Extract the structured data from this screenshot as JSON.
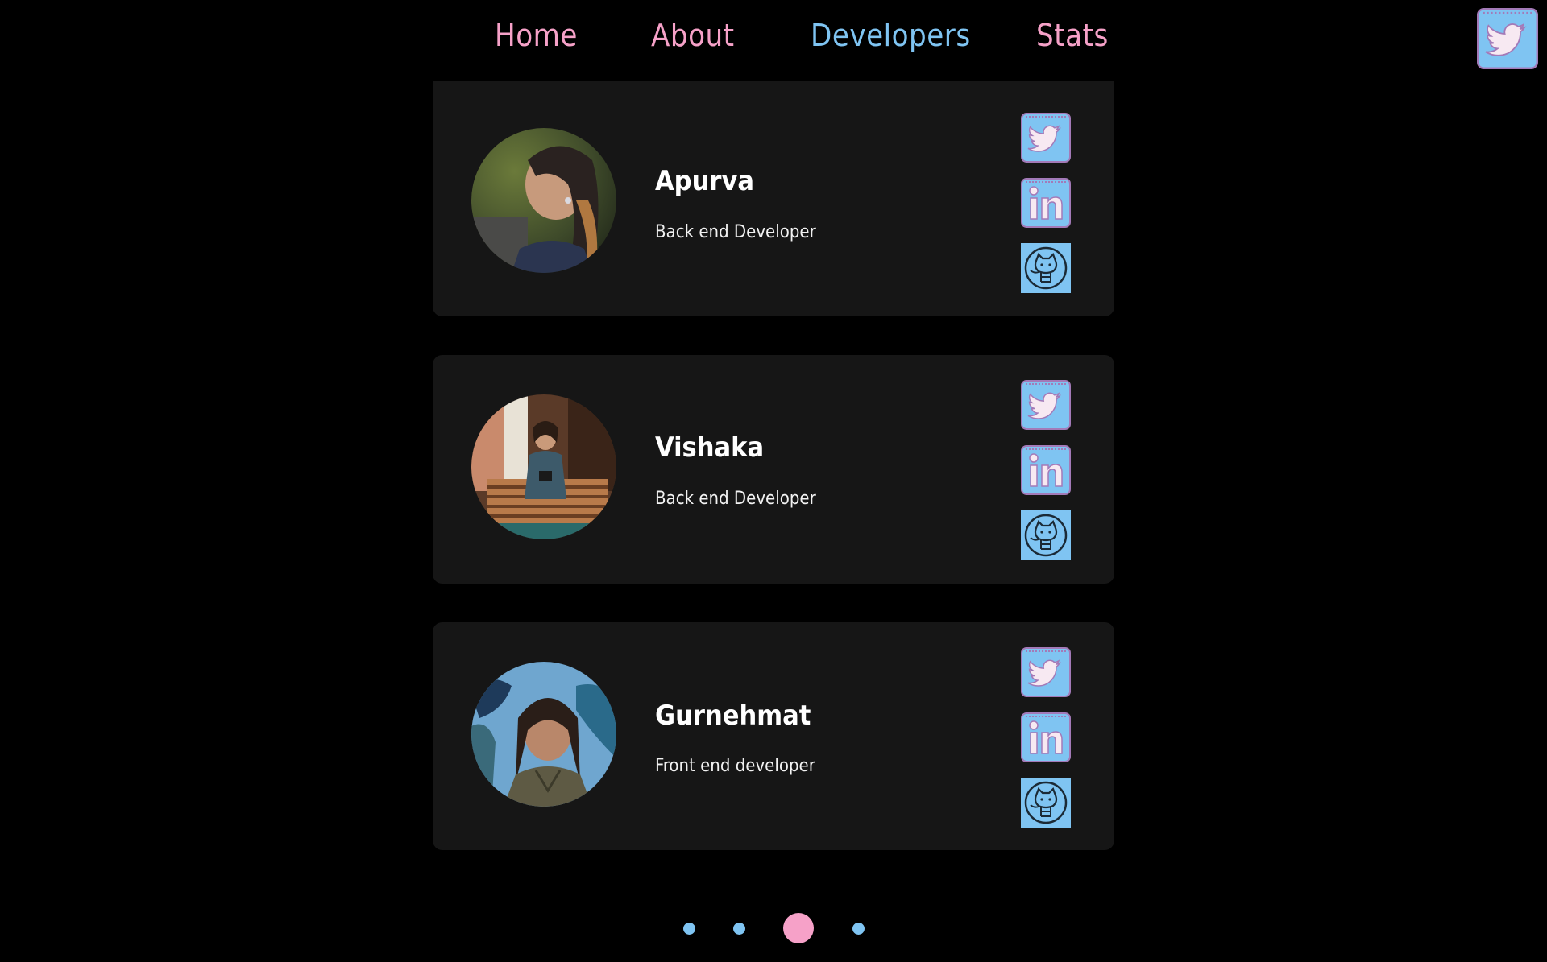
{
  "nav": {
    "home": "Home",
    "about": "About",
    "developers": "Developers",
    "stats": "Stats",
    "active": "developers"
  },
  "colors": {
    "nav_text": "#f6a1c8",
    "nav_active": "#7fc4f2",
    "card_bg": "#161616",
    "icon_bg": "#7fc4f2",
    "icon_border": "#a37ab8",
    "dot": "#7fc4f2",
    "dot_active": "#f6a1c8"
  },
  "developers": [
    {
      "name": "Apurva",
      "role": "Back end Developer"
    },
    {
      "name": "Vishaka",
      "role": "Back end Developer"
    },
    {
      "name": "Gurnehmat",
      "role": "Front end developer"
    }
  ],
  "social_icons": [
    "twitter-icon",
    "linkedin-icon",
    "github-icon"
  ],
  "pagination": {
    "count": 4,
    "active": 3
  }
}
